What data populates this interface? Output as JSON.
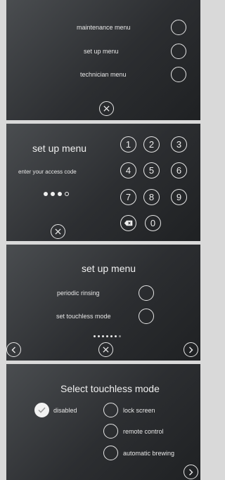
{
  "menu_panel": {
    "items": [
      {
        "label": "maintenance menu"
      },
      {
        "label": "set up menu"
      },
      {
        "label": "technician menu"
      }
    ]
  },
  "code_panel": {
    "title": "set up menu",
    "prompt": "enter your access code",
    "keys": [
      "1",
      "2",
      "3",
      "4",
      "5",
      "6",
      "7",
      "8",
      "9",
      "0"
    ],
    "code_entered": 3,
    "code_length": 4
  },
  "setup_panel": {
    "title": "set up menu",
    "items": [
      {
        "label": "periodic rinsing"
      },
      {
        "label": "set touchless mode"
      }
    ],
    "page_count": 7,
    "current_page": 6
  },
  "touchless_panel": {
    "title": "Select touchless mode",
    "options": [
      {
        "label": "disabled",
        "selected": true
      },
      {
        "label": "lock screen",
        "selected": false
      },
      {
        "label": "remote control",
        "selected": false
      },
      {
        "label": "automatic brewing",
        "selected": false
      }
    ]
  },
  "icons": {
    "close": "close-icon",
    "backspace": "backspace-icon",
    "prev": "chevron-left-icon",
    "next": "chevron-right-icon",
    "check": "check-icon"
  }
}
